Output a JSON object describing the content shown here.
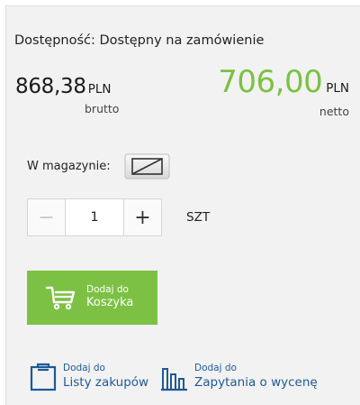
{
  "availability": {
    "text": "Dostępność: Dostępny na zamówienie"
  },
  "prices": {
    "gross": {
      "amount": "868,38",
      "currency": "PLN",
      "label": "brutto"
    },
    "net": {
      "amount": "706,00",
      "currency": "PLN",
      "label": "netto"
    },
    "net_color": "#7cc143"
  },
  "stock": {
    "label": "W magazynie:",
    "icon": "no-stock-icon"
  },
  "quantity": {
    "value": "1",
    "minus": "−",
    "plus": "+",
    "unit": "SZT"
  },
  "add_to_cart": {
    "line1": "Dodaj do",
    "line2": "Koszyka",
    "icon": "cart-icon",
    "color": "#7cc143"
  },
  "shopping_list": {
    "line1": "Dodaj do",
    "line2": "Listy zakupów",
    "icon": "clipboard-icon"
  },
  "quote_request": {
    "line1": "Dodaj do",
    "line2": "Zapytania o wycenę",
    "icon": "bar-chart-icon"
  },
  "link_color": "#1e5a96"
}
